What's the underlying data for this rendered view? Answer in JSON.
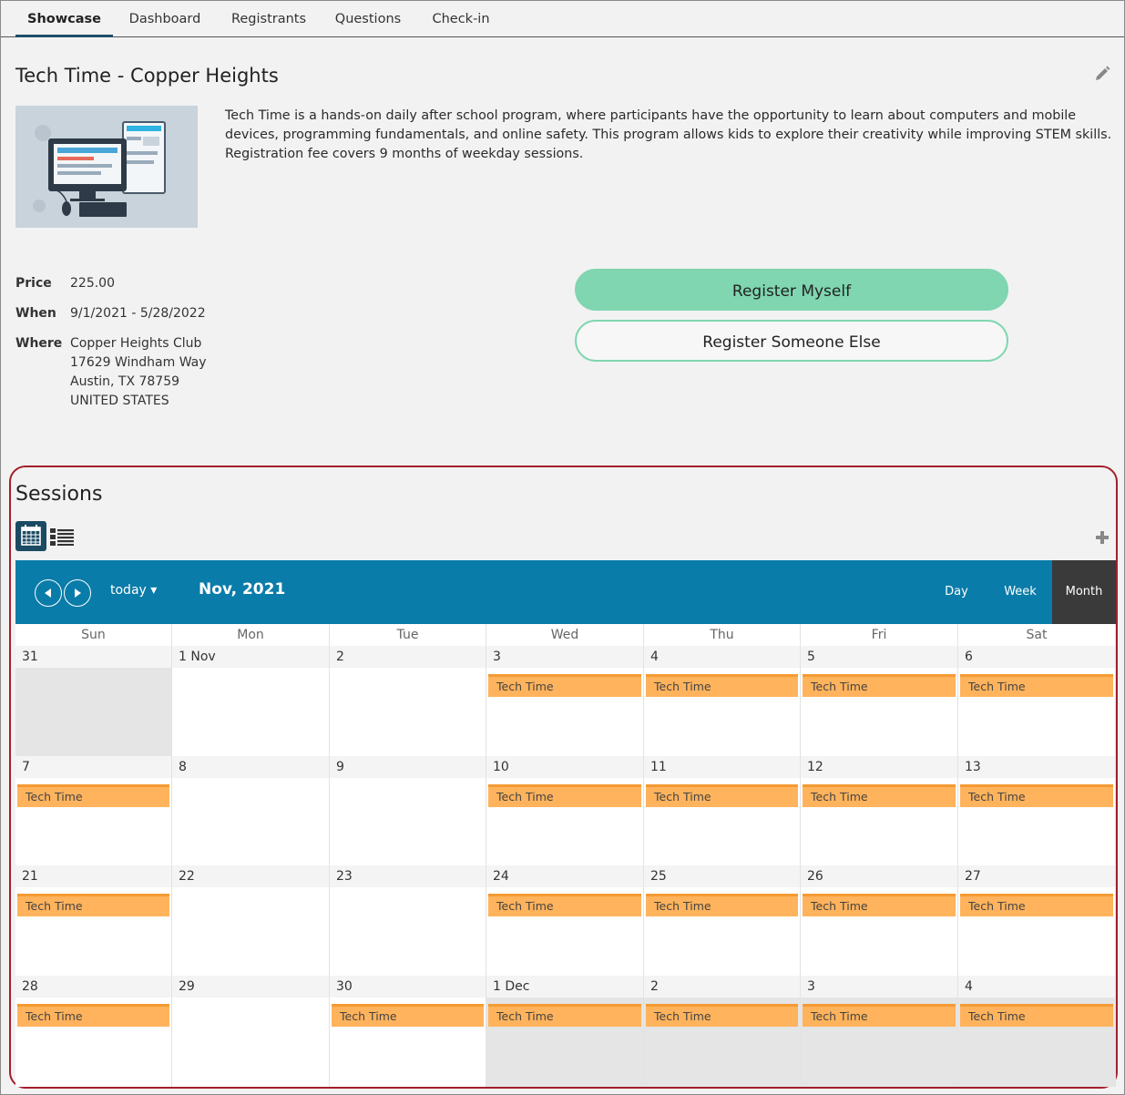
{
  "tabs": [
    "Showcase",
    "Dashboard",
    "Registrants",
    "Questions",
    "Check-in"
  ],
  "program": {
    "title": "Tech Time - Copper Heights",
    "description": "Tech Time is a hands-on daily after school program, where participants have the opportunity to learn about computers and mobile devices, programming fundamentals, and online safety. This program allows kids to explore their creativity while improving STEM skills. Registration fee covers 9 months of weekday sessions.",
    "price_label": "Price",
    "price": "225.00",
    "when_label": "When",
    "when": "9/1/2021 - 5/28/2022",
    "where_label": "Where",
    "where_lines": [
      "Copper Heights Club",
      "17629 Windham Way",
      "Austin, TX 78759",
      "UNITED STATES"
    ]
  },
  "buttons": {
    "register_myself": "Register Myself",
    "register_someone": "Register Someone Else"
  },
  "sessions": {
    "title": "Sessions",
    "today_label": "today ▾",
    "month_label": "Nov, 2021",
    "views": [
      "Day",
      "Week",
      "Month"
    ],
    "active_view": "Month",
    "weekdays": [
      "Sun",
      "Mon",
      "Tue",
      "Wed",
      "Thu",
      "Fri",
      "Sat"
    ],
    "weeks": [
      [
        {
          "label": "31",
          "other": true,
          "event": null
        },
        {
          "label": "1 Nov",
          "other": false,
          "event": null
        },
        {
          "label": "2",
          "other": false,
          "event": null
        },
        {
          "label": "3",
          "other": false,
          "event": "Tech Time"
        },
        {
          "label": "4",
          "other": false,
          "event": "Tech Time"
        },
        {
          "label": "5",
          "other": false,
          "event": "Tech Time"
        },
        {
          "label": "6",
          "other": false,
          "event": "Tech Time"
        }
      ],
      [
        {
          "label": "7",
          "other": false,
          "event": "Tech Time"
        },
        {
          "label": "8",
          "other": false,
          "event": null
        },
        {
          "label": "9",
          "other": false,
          "event": null
        },
        {
          "label": "10",
          "other": false,
          "event": "Tech Time"
        },
        {
          "label": "11",
          "other": false,
          "event": "Tech Time"
        },
        {
          "label": "12",
          "other": false,
          "event": "Tech Time"
        },
        {
          "label": "13",
          "other": false,
          "event": "Tech Time"
        }
      ],
      [
        {
          "label": "21",
          "other": false,
          "event": "Tech Time"
        },
        {
          "label": "22",
          "other": false,
          "event": null
        },
        {
          "label": "23",
          "other": false,
          "event": null
        },
        {
          "label": "24",
          "other": false,
          "event": "Tech Time"
        },
        {
          "label": "25",
          "other": false,
          "event": "Tech Time"
        },
        {
          "label": "26",
          "other": false,
          "event": "Tech Time"
        },
        {
          "label": "27",
          "other": false,
          "event": "Tech Time"
        }
      ],
      [
        {
          "label": "28",
          "other": false,
          "event": "Tech Time"
        },
        {
          "label": "29",
          "other": false,
          "event": null
        },
        {
          "label": "30",
          "other": false,
          "event": "Tech Time"
        },
        {
          "label": "1 Dec",
          "other": true,
          "event": "Tech Time"
        },
        {
          "label": "2",
          "other": true,
          "event": "Tech Time"
        },
        {
          "label": "3",
          "other": true,
          "event": "Tech Time"
        },
        {
          "label": "4",
          "other": true,
          "event": "Tech Time"
        }
      ]
    ]
  },
  "colors": {
    "accent_dark": "#1e4e66",
    "toolbar_blue": "#0a7ca9",
    "button_green": "#7fd6b0",
    "event_orange": "#ffb35c",
    "highlight_border": "#a31f2c"
  }
}
